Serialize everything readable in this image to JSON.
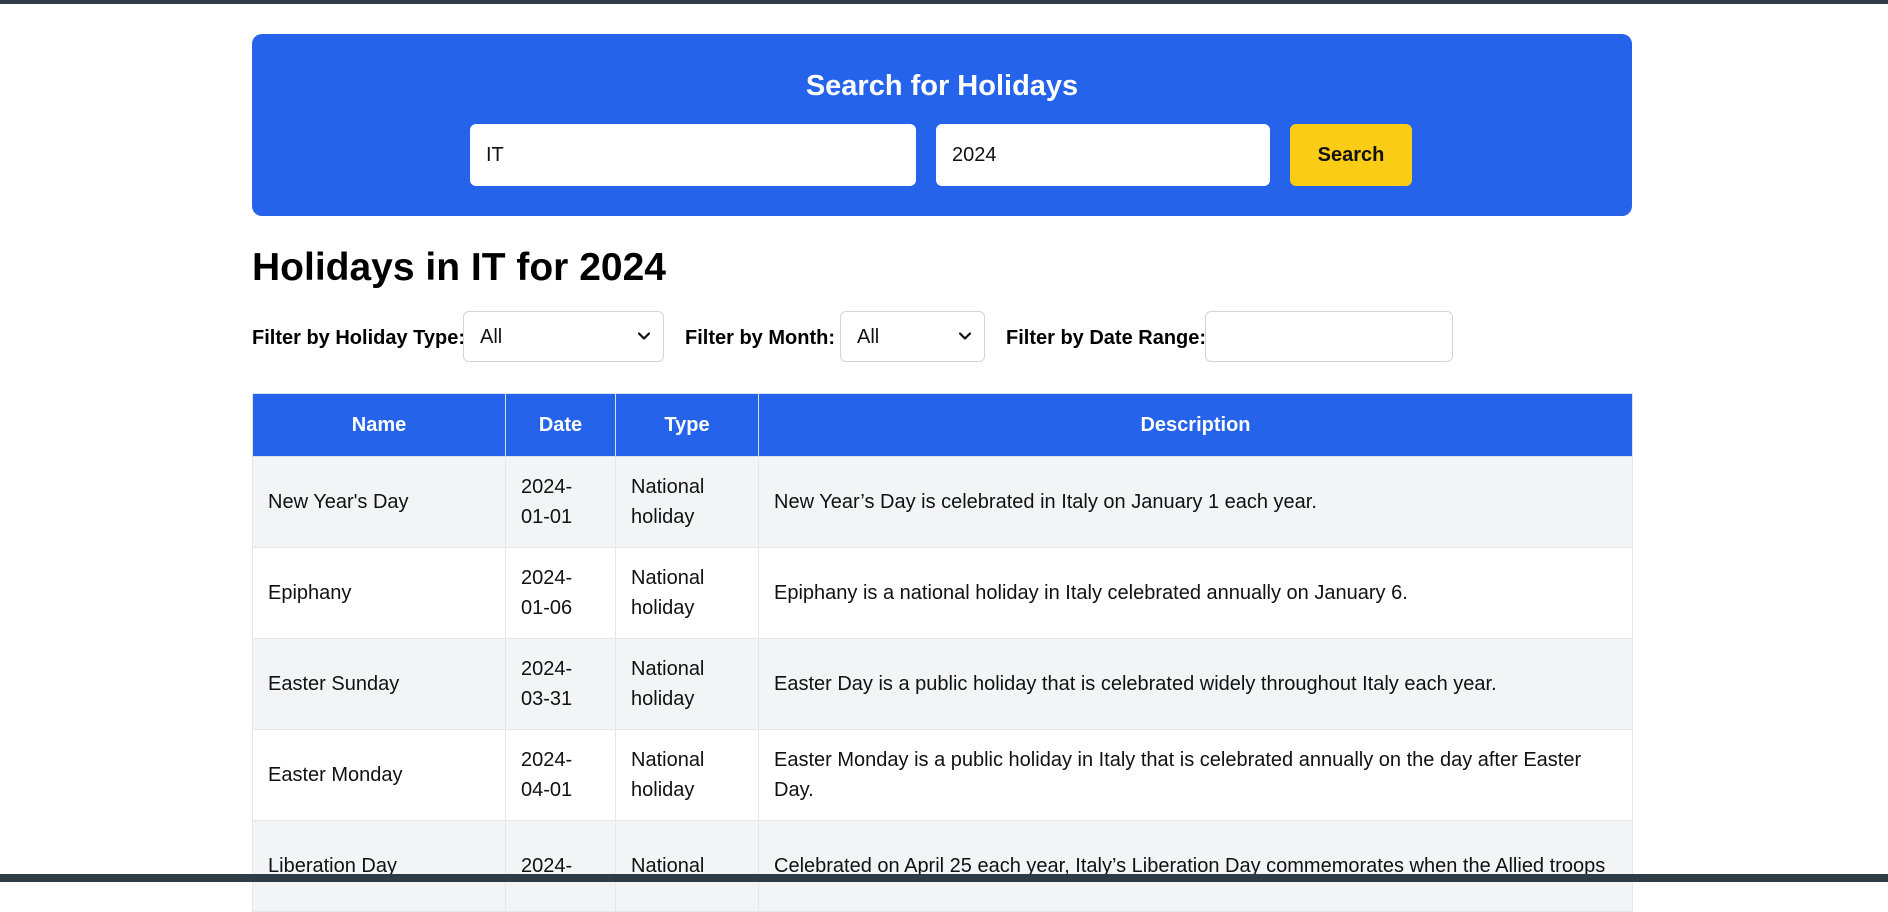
{
  "search": {
    "title": "Search for Holidays",
    "country_value": "IT",
    "year_value": "2024",
    "button_label": "Search"
  },
  "results": {
    "heading": "Holidays in IT for 2024"
  },
  "filters": {
    "type_label": "Filter by Holiday Type:",
    "type_selected": "All",
    "month_label": "Filter by Month:",
    "month_selected": "All",
    "date_range_label": "Filter by Date Range:",
    "date_range_value": ""
  },
  "table": {
    "columns": [
      "Name",
      "Date",
      "Type",
      "Description"
    ],
    "rows": [
      {
        "name": "New Year's Day",
        "date": "2024-01-01",
        "type": "National holiday",
        "description": "New Year’s Day is celebrated in Italy on January 1 each year."
      },
      {
        "name": "Epiphany",
        "date": "2024-01-06",
        "type": "National holiday",
        "description": "Epiphany is a national holiday in Italy celebrated annually on January 6."
      },
      {
        "name": "Easter Sunday",
        "date": "2024-03-31",
        "type": "National holiday",
        "description": "Easter Day is a public holiday that is celebrated widely throughout Italy each year."
      },
      {
        "name": "Easter Monday",
        "date": "2024-04-01",
        "type": "National holiday",
        "description": "Easter Monday is a public holiday in Italy that is celebrated annually on the day after Easter Day."
      },
      {
        "name": "Liberation Day",
        "date": "2024-",
        "type": "National",
        "description": "Celebrated on April 25 each year, Italy’s Liberation Day commemorates when the Allied troops"
      }
    ]
  },
  "colors": {
    "primary": "#2563eb",
    "accent": "#facc15",
    "row_alt": "#f3f4f6"
  },
  "icons": {
    "select_chevron": "chevron-down-icon"
  }
}
